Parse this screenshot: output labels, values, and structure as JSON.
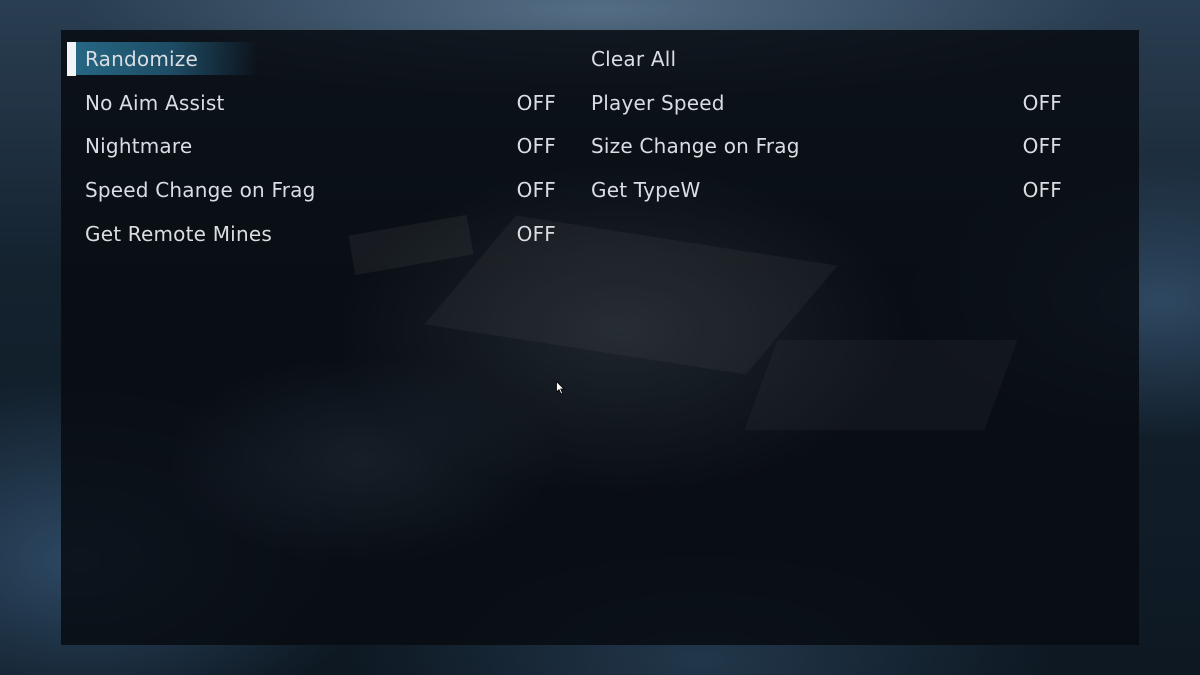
{
  "menu": {
    "left_column": [
      {
        "label": "Randomize",
        "value": ""
      },
      {
        "label": "No Aim Assist",
        "value": "OFF"
      },
      {
        "label": "Nightmare",
        "value": "OFF"
      },
      {
        "label": "Speed Change on Frag",
        "value": "OFF"
      },
      {
        "label": "Get Remote Mines",
        "value": "OFF"
      }
    ],
    "right_column": [
      {
        "label": "Clear All",
        "value": ""
      },
      {
        "label": "Player Speed",
        "value": "OFF"
      },
      {
        "label": "Size Change on Frag",
        "value": "OFF"
      },
      {
        "label": "Get TypeW",
        "value": "OFF"
      }
    ],
    "selected": "Randomize"
  },
  "colors": {
    "highlight": "#2a7090",
    "text": "#dadee2",
    "selection_bar": "#f1f4f6",
    "panel": "#080c11"
  },
  "icons": {
    "pointer": "mouse-pointer-icon"
  }
}
